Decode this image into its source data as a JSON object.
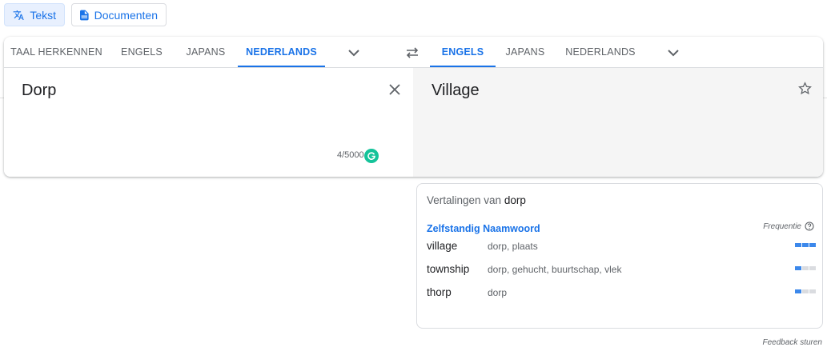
{
  "modes": {
    "text_label": "Tekst",
    "docs_label": "Documenten"
  },
  "source_langs": [
    "TAAL HERKENNEN",
    "ENGELS",
    "JAPANS",
    "NEDERLANDS"
  ],
  "target_langs": [
    "ENGELS",
    "JAPANS",
    "NEDERLANDS"
  ],
  "source": {
    "text": "Dorp",
    "counter": "4/5000"
  },
  "target": {
    "text": "Village"
  },
  "dictionary": {
    "title_prefix": "Vertalingen van",
    "title_word": "dorp",
    "part_of_speech": "Zelfstandig Naamwoord",
    "frequency_label": "Frequentie",
    "rows": [
      {
        "word": "village",
        "synonyms": "dorp, plaats",
        "frequency": 3
      },
      {
        "word": "township",
        "synonyms": "dorp, gehucht, buurtschap, vlek",
        "frequency": 1
      },
      {
        "word": "thorp",
        "synonyms": "dorp",
        "frequency": 1
      }
    ]
  },
  "feedback_label": "Feedback sturen",
  "colors": {
    "accent": "#1a73e8",
    "grammarly": "#15c39a"
  }
}
